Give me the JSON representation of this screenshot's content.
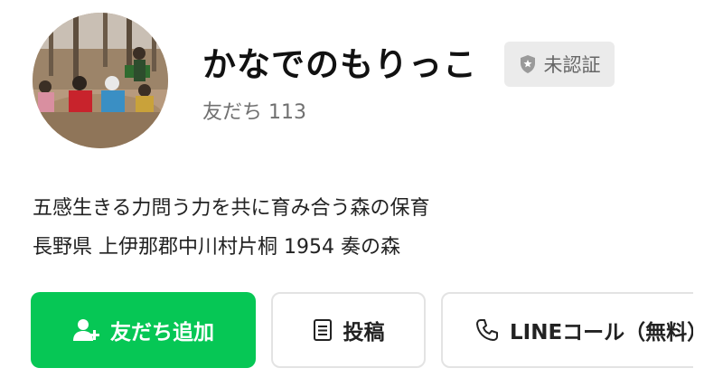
{
  "profile": {
    "name": "かなでのもりっこ",
    "badge_label": "未認証",
    "friends_label": "友だち 113",
    "avatar_description_icon": "profile-photo"
  },
  "description": {
    "line1": "五感生きる力問う力を共に育み合う森の保育",
    "line2": "長野県 上伊那郡中川村片桐 1954 奏の森"
  },
  "actions": {
    "add_friend_label": "友だち追加",
    "post_label": "投稿",
    "call_label": "LINEコール（無料）"
  },
  "colors": {
    "accent_green": "#06c755",
    "badge_bg": "#ebebeb",
    "muted_text": "#707070"
  },
  "icons": {
    "badge": "shield-icon",
    "add_friend": "person-add-icon",
    "post": "document-icon",
    "call": "phone-icon"
  }
}
